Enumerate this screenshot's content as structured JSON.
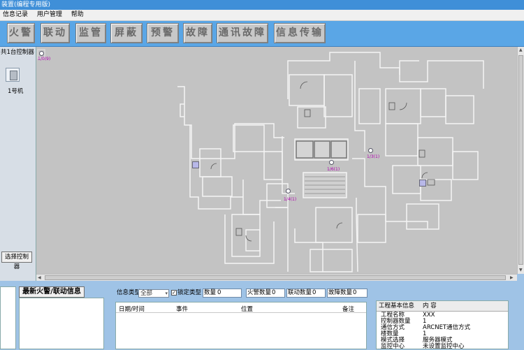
{
  "window": {
    "title": "装置(编程专用版)"
  },
  "menu": [
    "信息记录",
    "用户管理",
    "帮助"
  ],
  "toolbar": [
    {
      "label": "火警"
    },
    {
      "label": "联动"
    },
    {
      "label": "监管"
    },
    {
      "label": "屏蔽"
    },
    {
      "label": "预警"
    },
    {
      "label": "故障"
    },
    {
      "label": "通讯故障"
    },
    {
      "label": "信息传输"
    }
  ],
  "sidebar": {
    "controller_count": "共1台控制器",
    "controller_label": "1号机",
    "select_button": "选择控制器"
  },
  "map": {
    "devices": [
      {
        "id": "dev-topleft",
        "label": "1/0(9)"
      },
      {
        "id": "dev-center",
        "label": "1/6(1)"
      },
      {
        "id": "dev-right",
        "label": "1/3(1)"
      },
      {
        "id": "dev-lower",
        "label": "1/4(1)"
      }
    ]
  },
  "bottom": {
    "latest_title": "最新火警/联动信息",
    "filters": {
      "type_label": "信息类型",
      "type_value": "全部",
      "lock_label": "锁定类型",
      "lock_checked": true,
      "count_label": "数量",
      "count_value": "0",
      "fire_label": "火警数量",
      "fire_value": "0",
      "link_label": "联动数量",
      "link_value": "0",
      "fault_label": "故障数量",
      "fault_value": "0"
    },
    "table_headers": [
      "日期/时间",
      "事件",
      "位置",
      "备注"
    ],
    "info": {
      "header_key": "工程基本信息",
      "header_val": "内 容",
      "rows": [
        {
          "k": "工程名称",
          "v": "XXX"
        },
        {
          "k": "控制器数量",
          "v": "1"
        },
        {
          "k": "通信方式",
          "v": "ARCNET通信方式"
        },
        {
          "k": "楼数量",
          "v": "1"
        },
        {
          "k": "模式选择",
          "v": "服务器模式"
        },
        {
          "k": "监控中心",
          "v": "未设置监控中心"
        }
      ]
    }
  },
  "colors": {
    "toolbar_bg": "#5aa6e6",
    "title_bg": "#3f8fd8",
    "map_bg": "#c3c3c3",
    "device_label": "#b000b0"
  }
}
